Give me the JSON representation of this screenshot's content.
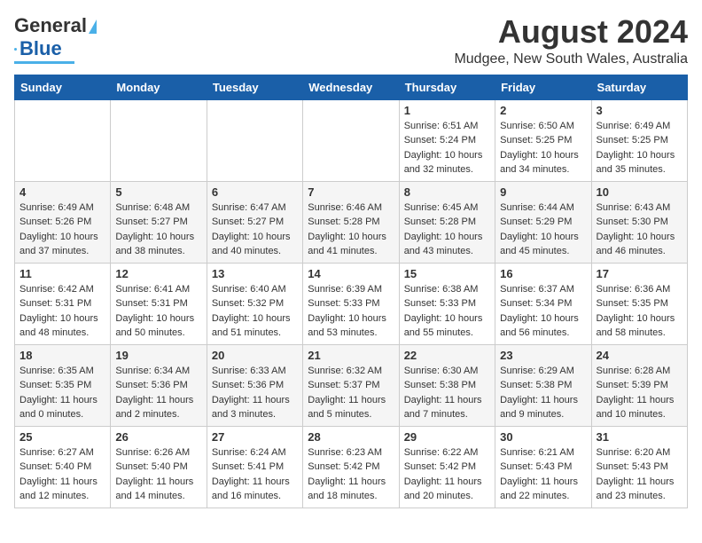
{
  "header": {
    "logo_line1": "General",
    "logo_line2": "Blue",
    "title": "August 2024",
    "subtitle": "Mudgee, New South Wales, Australia"
  },
  "days_of_week": [
    "Sunday",
    "Monday",
    "Tuesday",
    "Wednesday",
    "Thursday",
    "Friday",
    "Saturday"
  ],
  "weeks": [
    {
      "stripe": "odd",
      "days": [
        {
          "num": "",
          "info": ""
        },
        {
          "num": "",
          "info": ""
        },
        {
          "num": "",
          "info": ""
        },
        {
          "num": "",
          "info": ""
        },
        {
          "num": "1",
          "info": "Sunrise: 6:51 AM\nSunset: 5:24 PM\nDaylight: 10 hours\nand 32 minutes."
        },
        {
          "num": "2",
          "info": "Sunrise: 6:50 AM\nSunset: 5:25 PM\nDaylight: 10 hours\nand 34 minutes."
        },
        {
          "num": "3",
          "info": "Sunrise: 6:49 AM\nSunset: 5:25 PM\nDaylight: 10 hours\nand 35 minutes."
        }
      ]
    },
    {
      "stripe": "even",
      "days": [
        {
          "num": "4",
          "info": "Sunrise: 6:49 AM\nSunset: 5:26 PM\nDaylight: 10 hours\nand 37 minutes."
        },
        {
          "num": "5",
          "info": "Sunrise: 6:48 AM\nSunset: 5:27 PM\nDaylight: 10 hours\nand 38 minutes."
        },
        {
          "num": "6",
          "info": "Sunrise: 6:47 AM\nSunset: 5:27 PM\nDaylight: 10 hours\nand 40 minutes."
        },
        {
          "num": "7",
          "info": "Sunrise: 6:46 AM\nSunset: 5:28 PM\nDaylight: 10 hours\nand 41 minutes."
        },
        {
          "num": "8",
          "info": "Sunrise: 6:45 AM\nSunset: 5:28 PM\nDaylight: 10 hours\nand 43 minutes."
        },
        {
          "num": "9",
          "info": "Sunrise: 6:44 AM\nSunset: 5:29 PM\nDaylight: 10 hours\nand 45 minutes."
        },
        {
          "num": "10",
          "info": "Sunrise: 6:43 AM\nSunset: 5:30 PM\nDaylight: 10 hours\nand 46 minutes."
        }
      ]
    },
    {
      "stripe": "odd",
      "days": [
        {
          "num": "11",
          "info": "Sunrise: 6:42 AM\nSunset: 5:31 PM\nDaylight: 10 hours\nand 48 minutes."
        },
        {
          "num": "12",
          "info": "Sunrise: 6:41 AM\nSunset: 5:31 PM\nDaylight: 10 hours\nand 50 minutes."
        },
        {
          "num": "13",
          "info": "Sunrise: 6:40 AM\nSunset: 5:32 PM\nDaylight: 10 hours\nand 51 minutes."
        },
        {
          "num": "14",
          "info": "Sunrise: 6:39 AM\nSunset: 5:33 PM\nDaylight: 10 hours\nand 53 minutes."
        },
        {
          "num": "15",
          "info": "Sunrise: 6:38 AM\nSunset: 5:33 PM\nDaylight: 10 hours\nand 55 minutes."
        },
        {
          "num": "16",
          "info": "Sunrise: 6:37 AM\nSunset: 5:34 PM\nDaylight: 10 hours\nand 56 minutes."
        },
        {
          "num": "17",
          "info": "Sunrise: 6:36 AM\nSunset: 5:35 PM\nDaylight: 10 hours\nand 58 minutes."
        }
      ]
    },
    {
      "stripe": "even",
      "days": [
        {
          "num": "18",
          "info": "Sunrise: 6:35 AM\nSunset: 5:35 PM\nDaylight: 11 hours\nand 0 minutes."
        },
        {
          "num": "19",
          "info": "Sunrise: 6:34 AM\nSunset: 5:36 PM\nDaylight: 11 hours\nand 2 minutes."
        },
        {
          "num": "20",
          "info": "Sunrise: 6:33 AM\nSunset: 5:36 PM\nDaylight: 11 hours\nand 3 minutes."
        },
        {
          "num": "21",
          "info": "Sunrise: 6:32 AM\nSunset: 5:37 PM\nDaylight: 11 hours\nand 5 minutes."
        },
        {
          "num": "22",
          "info": "Sunrise: 6:30 AM\nSunset: 5:38 PM\nDaylight: 11 hours\nand 7 minutes."
        },
        {
          "num": "23",
          "info": "Sunrise: 6:29 AM\nSunset: 5:38 PM\nDaylight: 11 hours\nand 9 minutes."
        },
        {
          "num": "24",
          "info": "Sunrise: 6:28 AM\nSunset: 5:39 PM\nDaylight: 11 hours\nand 10 minutes."
        }
      ]
    },
    {
      "stripe": "odd",
      "days": [
        {
          "num": "25",
          "info": "Sunrise: 6:27 AM\nSunset: 5:40 PM\nDaylight: 11 hours\nand 12 minutes."
        },
        {
          "num": "26",
          "info": "Sunrise: 6:26 AM\nSunset: 5:40 PM\nDaylight: 11 hours\nand 14 minutes."
        },
        {
          "num": "27",
          "info": "Sunrise: 6:24 AM\nSunset: 5:41 PM\nDaylight: 11 hours\nand 16 minutes."
        },
        {
          "num": "28",
          "info": "Sunrise: 6:23 AM\nSunset: 5:42 PM\nDaylight: 11 hours\nand 18 minutes."
        },
        {
          "num": "29",
          "info": "Sunrise: 6:22 AM\nSunset: 5:42 PM\nDaylight: 11 hours\nand 20 minutes."
        },
        {
          "num": "30",
          "info": "Sunrise: 6:21 AM\nSunset: 5:43 PM\nDaylight: 11 hours\nand 22 minutes."
        },
        {
          "num": "31",
          "info": "Sunrise: 6:20 AM\nSunset: 5:43 PM\nDaylight: 11 hours\nand 23 minutes."
        }
      ]
    }
  ]
}
